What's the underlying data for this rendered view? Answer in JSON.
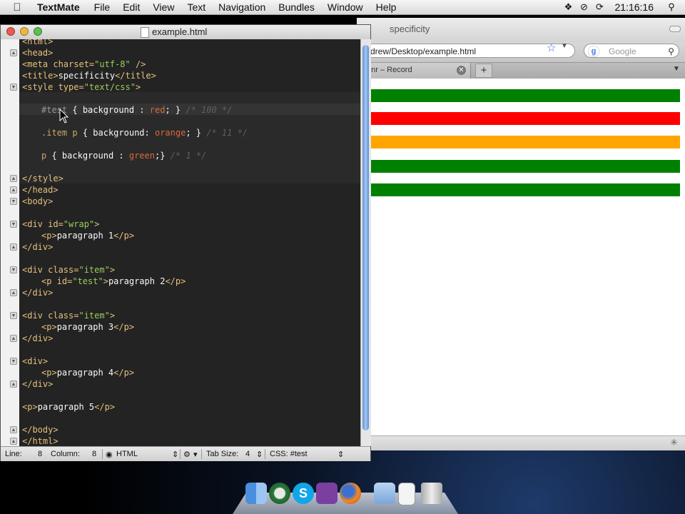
{
  "menubar": {
    "app": "TextMate",
    "items": [
      "File",
      "Edit",
      "View",
      "Text",
      "Navigation",
      "Bundles",
      "Window",
      "Help"
    ],
    "status_icons": [
      "dropbox-icon",
      "prohibited-icon",
      "sync-icon"
    ],
    "clock": "21:16:16",
    "search_icon": "spotlight-icon"
  },
  "browser": {
    "title": "specificity",
    "url": "drew/Desktop/example.html",
    "search_placeholder": "Google",
    "tab_label": "enr – Record",
    "new_tab": "+",
    "bars": [
      "#008000",
      "#ff0000",
      "#ffa500",
      "#008000",
      "#008000"
    ]
  },
  "editor": {
    "title": "example.html",
    "status": {
      "line_label": "Line:",
      "line_value": "8",
      "column_label": "Column:",
      "column_value": "8",
      "language": "HTML",
      "tab_size_label": "Tab Size:",
      "tab_size_value": "4",
      "symbol": "CSS: #test"
    }
  },
  "code": {
    "l0": "<html>",
    "l1_tag": "<head>",
    "l2_a": "<meta charset=",
    "l2_s": "\"utf-8\"",
    "l2_b": " />",
    "l3_a": "<title>",
    "l3_t": "specificity",
    "l3_b": "</title>",
    "l4_a": "<style type=",
    "l4_s": "\"text/css\"",
    "l4_b": ">",
    "l5_sel": "#test",
    "l5_a": " { ",
    "l5_p": "background",
    "l5_c": " : ",
    "l5_v": "red",
    "l5_e": "; } ",
    "l5_cm": "/* 100 */",
    "l6_sel": ".item p",
    "l6_a": " { ",
    "l6_p": "background",
    "l6_c": ": ",
    "l6_v": "orange",
    "l6_e": "; } ",
    "l6_cm": "/* 11 */",
    "l7_sel": "p",
    "l7_a": " { ",
    "l7_p": "background",
    "l7_c": " : ",
    "l7_v": "green",
    "l7_e": ";} ",
    "l7_cm": "/* 1 */",
    "l8": "</style>",
    "l9": "</head>",
    "l10": "<body>",
    "l11_a": "<div id=",
    "l11_s": "\"wrap\"",
    "l11_b": ">",
    "l12_a": "<p>",
    "l12_t": "paragraph 1",
    "l12_b": "</p>",
    "l13": "</div>",
    "l14_a": "<div class=",
    "l14_s": "\"item\"",
    "l14_b": ">",
    "l15_a": "<p id=",
    "l15_s": "\"test\"",
    "l15_b": ">",
    "l15_t": "paragraph 2",
    "l15_c": "</p>",
    "l16": "</div>",
    "l17_a": "<div class=",
    "l17_s": "\"item\"",
    "l17_b": ">",
    "l18_a": "<p>",
    "l18_t": "paragraph 3",
    "l18_b": "</p>",
    "l19": "</div>",
    "l20": "<div>",
    "l21_a": "<p>",
    "l21_t": "paragraph 4",
    "l21_b": "</p>",
    "l22": "</div>",
    "l23_a": "<p>",
    "l23_t": "paragraph 5",
    "l23_b": "</p>",
    "l24": "</body>",
    "l25": "</html>"
  },
  "dock": {
    "items": [
      "finder-icon",
      "time-machine-icon",
      "skype-icon",
      "ical-icon",
      "firefox-icon",
      "folder-icon",
      "document-icon",
      "trash-icon"
    ]
  }
}
